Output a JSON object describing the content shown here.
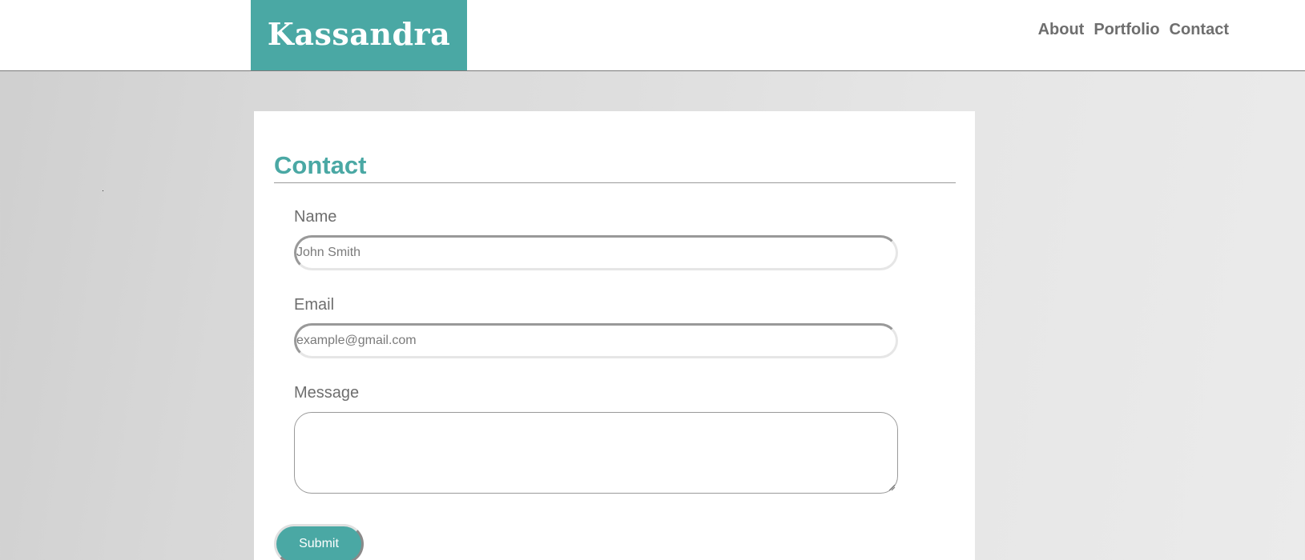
{
  "brand": {
    "name": "Kassandra",
    "color": "#4aa8a4"
  },
  "nav": {
    "items": [
      "About",
      "Portfolio",
      "Contact"
    ]
  },
  "contact": {
    "title": "Contact",
    "name_label": "Name",
    "name_placeholder": "John Smith",
    "email_label": "Email",
    "email_placeholder": "example@gmail.com",
    "message_label": "Message",
    "submit_label": "Submit"
  }
}
